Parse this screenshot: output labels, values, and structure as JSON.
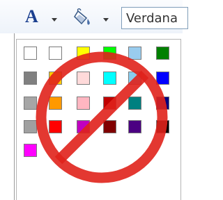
{
  "toolbar": {
    "font_color_label": "A",
    "font_name": "Verdana"
  },
  "palette": {
    "rows": [
      [
        "#ffffff",
        "#ffffff",
        "#ffff00",
        "#00ff00",
        "#99ccee",
        "#008000"
      ],
      [
        "#808080",
        "#ffcc00",
        "#ffdada",
        "#00ffff",
        "#88ccee",
        "#0000ff"
      ],
      [
        "#a6a6a6",
        "#ff9900",
        "#ffb6c1",
        "#c00000",
        "#008080",
        "#000080"
      ],
      [
        "#a0a0a0",
        "#ff0000",
        "#c000c0",
        "#800000",
        "#4b0082",
        "#000000"
      ],
      [
        "#ff00ff"
      ]
    ]
  },
  "overlay": {
    "icon": "prohibition-sign-icon",
    "color": "#e0221b"
  }
}
